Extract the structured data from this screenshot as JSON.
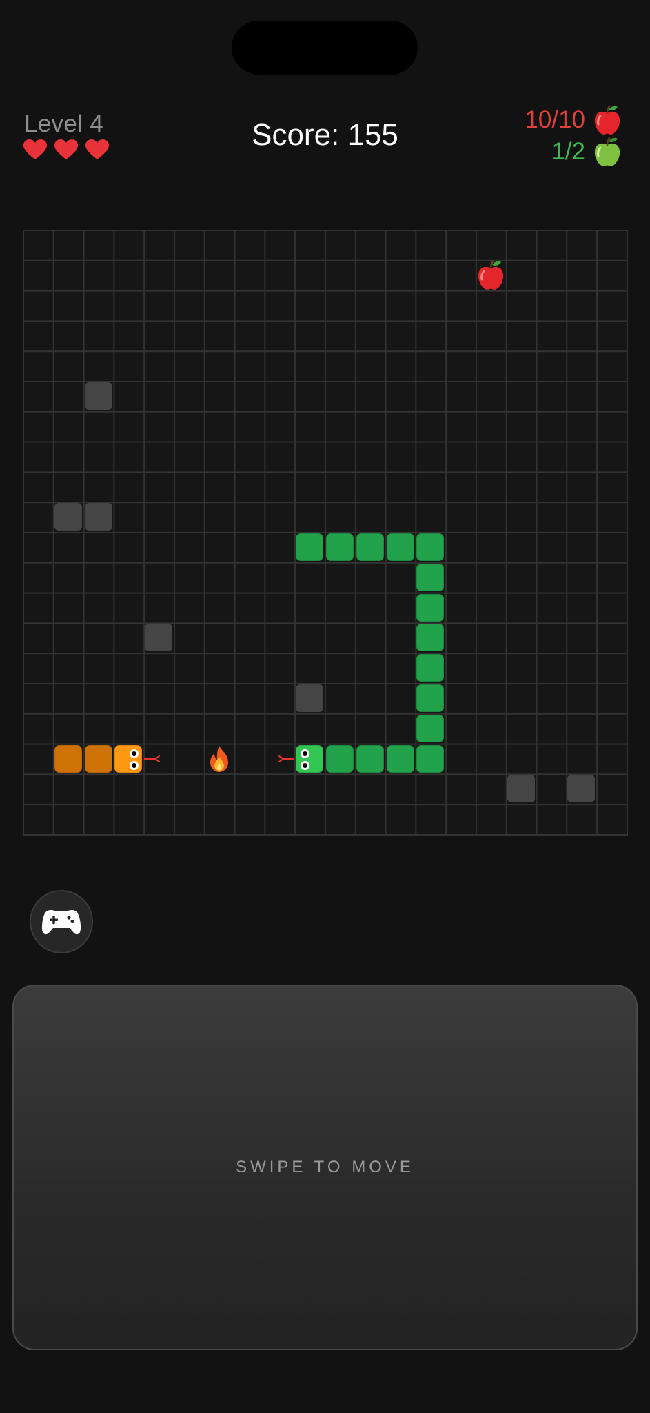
{
  "hud": {
    "level_label": "Level 4",
    "lives": 3,
    "score_label": "Score: 155",
    "red_apples": {
      "count_label": "10/10",
      "icon": "red-apple-icon",
      "color": "#e4403a"
    },
    "green_apples": {
      "count_label": "1/2",
      "icon": "green-apple-icon",
      "color": "#3db94f"
    }
  },
  "board": {
    "columns": 20,
    "rows": 20,
    "food": [
      {
        "type": "red-apple",
        "col": 15,
        "row": 1
      }
    ],
    "hazards": [
      {
        "type": "fire",
        "col": 6,
        "row": 17
      }
    ],
    "walls": [
      {
        "col": 2,
        "row": 5
      },
      {
        "col": 1,
        "row": 9
      },
      {
        "col": 2,
        "row": 9
      },
      {
        "col": 4,
        "row": 13
      },
      {
        "col": 9,
        "row": 15
      },
      {
        "col": 16,
        "row": 18
      },
      {
        "col": 18,
        "row": 18
      }
    ],
    "player_snake": {
      "color": "#22a24a",
      "head_color": "#34c653",
      "facing": "left",
      "segments": [
        {
          "col": 9,
          "row": 17
        },
        {
          "col": 10,
          "row": 17
        },
        {
          "col": 11,
          "row": 17
        },
        {
          "col": 12,
          "row": 17
        },
        {
          "col": 13,
          "row": 17
        },
        {
          "col": 13,
          "row": 16
        },
        {
          "col": 13,
          "row": 15
        },
        {
          "col": 13,
          "row": 14
        },
        {
          "col": 13,
          "row": 13
        },
        {
          "col": 13,
          "row": 12
        },
        {
          "col": 13,
          "row": 11
        },
        {
          "col": 13,
          "row": 10
        },
        {
          "col": 12,
          "row": 10
        },
        {
          "col": 11,
          "row": 10
        },
        {
          "col": 10,
          "row": 10
        },
        {
          "col": 9,
          "row": 10
        }
      ]
    },
    "enemy_snake": {
      "color": "#cf7206",
      "head_color": "#ff9812",
      "facing": "right",
      "segments": [
        {
          "col": 3,
          "row": 17
        },
        {
          "col": 2,
          "row": 17
        },
        {
          "col": 1,
          "row": 17
        }
      ]
    }
  },
  "controls": {
    "gamepad_icon": "gamepad-icon",
    "swipe_hint": "SWIPE TO MOVE"
  }
}
